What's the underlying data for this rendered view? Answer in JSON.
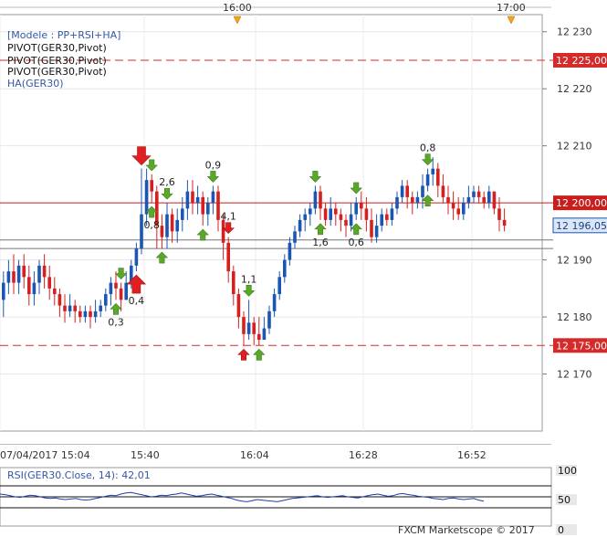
{
  "chart_data": [
    {
      "type": "candlestick",
      "symbol": "GER30",
      "legend": [
        "[Modele : PP+RSI+HA]",
        "PIVOT(GER30,Pivot)",
        "PIVOT(GER30,Pivot)",
        "PIVOT(GER30,Pivot)",
        "HA(GER30)"
      ],
      "top_time_labels": [
        "16:00",
        "17:00"
      ],
      "x_tick_labels": [
        "07/04/2017 15:04",
        "15:40",
        "16:04",
        "16:28",
        "16:52"
      ],
      "y_tick_labels": [
        "12 230",
        "12 220",
        "12 210",
        "12 190",
        "12 180",
        "12 170"
      ],
      "ylim": [
        12160,
        12233
      ],
      "levels": [
        {
          "value": 12225,
          "label": "12 225,00",
          "style": "dashed",
          "color": "#d42a2a"
        },
        {
          "value": 12200,
          "label": "12 200,00",
          "style": "solid",
          "color": "#c81e1e"
        },
        {
          "value": 12175,
          "label": "12 175,00",
          "style": "dashed",
          "color": "#d42a2a"
        },
        {
          "value": 12192,
          "label": "",
          "style": "solid",
          "color": "#777777"
        },
        {
          "value": 12193.5,
          "label": "",
          "style": "solid",
          "color": "#777777"
        }
      ],
      "last_price": {
        "value": 12196.05,
        "label": "12 196,05"
      },
      "bull_color": "#1b56b5",
      "bear_color": "#d62020",
      "candles": [
        [
          12183,
          12186,
          12180,
          12188
        ],
        [
          12186,
          12188,
          12184,
          12190
        ],
        [
          12188,
          12186,
          12184,
          12191
        ],
        [
          12186,
          12189,
          12184,
          12190
        ],
        [
          12189,
          12187,
          12185,
          12191
        ],
        [
          12187,
          12184,
          12182,
          12189
        ],
        [
          12184,
          12186,
          12182,
          12188
        ],
        [
          12186,
          12189,
          12184,
          12190
        ],
        [
          12189,
          12187,
          12185,
          12191
        ],
        [
          12187,
          12185,
          12183,
          12189
        ],
        [
          12185,
          12184,
          12182,
          12187
        ],
        [
          12184,
          12182,
          12180,
          12185
        ],
        [
          12182,
          12181,
          12179,
          12184
        ],
        [
          12181,
          12182,
          12180,
          12184
        ],
        [
          12182,
          12181,
          12179,
          12183
        ],
        [
          12181,
          12180,
          12179,
          12182
        ],
        [
          12180,
          12181,
          12179,
          12182
        ],
        [
          12181,
          12180,
          12178,
          12182
        ],
        [
          12180,
          12181,
          12179,
          12183
        ],
        [
          12181,
          12182,
          12180,
          12183
        ],
        [
          12182,
          12184,
          12181,
          12185
        ],
        [
          12184,
          12186,
          12182,
          12187
        ],
        [
          12186,
          12185,
          12183,
          12188
        ],
        [
          12185,
          12183,
          12181,
          12186
        ],
        [
          12183,
          12186,
          12183,
          12188
        ],
        [
          12186,
          12189,
          12185,
          12190
        ],
        [
          12189,
          12192,
          12188,
          12193
        ],
        [
          12192,
          12198,
          12191,
          12206
        ],
        [
          12198,
          12204,
          12196,
          12206
        ],
        [
          12204,
          12202,
          12200,
          12205
        ],
        [
          12202,
          12196,
          12192,
          12203
        ],
        [
          12196,
          12194,
          12192,
          12198
        ],
        [
          12194,
          12198,
          12192,
          12200
        ],
        [
          12198,
          12195,
          12193,
          12199
        ],
        [
          12195,
          12197,
          12193,
          12199
        ],
        [
          12197,
          12199,
          12195,
          12201
        ],
        [
          12199,
          12202,
          12197,
          12204
        ],
        [
          12202,
          12200,
          12198,
          12204
        ],
        [
          12200,
          12201,
          12198,
          12203
        ],
        [
          12201,
          12198,
          12196,
          12202
        ],
        [
          12198,
          12200,
          12196,
          12201
        ],
        [
          12200,
          12202,
          12198,
          12203
        ],
        [
          12202,
          12197,
          12195,
          12203
        ],
        [
          12197,
          12193,
          12190,
          12198
        ],
        [
          12193,
          12188,
          12186,
          12194
        ],
        [
          12188,
          12184,
          12182,
          12189
        ],
        [
          12184,
          12180,
          12178,
          12185
        ],
        [
          12180,
          12177,
          12175,
          12181
        ],
        [
          12177,
          12179,
          12176,
          12183
        ],
        [
          12179,
          12177,
          12175,
          12180
        ],
        [
          12177,
          12176,
          12175,
          12180
        ],
        [
          12176,
          12178,
          12176,
          12180
        ],
        [
          12178,
          12181,
          12177,
          12182
        ],
        [
          12181,
          12184,
          12180,
          12185
        ],
        [
          12184,
          12187,
          12183,
          12188
        ],
        [
          12187,
          12190,
          12186,
          12191
        ],
        [
          12190,
          12193,
          12189,
          12194
        ],
        [
          12193,
          12195,
          12192,
          12196
        ],
        [
          12195,
          12197,
          12194,
          12198
        ],
        [
          12197,
          12198,
          12195,
          12199
        ],
        [
          12198,
          12199,
          12196,
          12200
        ],
        [
          12199,
          12202,
          12198,
          12203
        ],
        [
          12202,
          12199,
          12197,
          12203
        ],
        [
          12199,
          12197,
          12196,
          12200
        ],
        [
          12197,
          12199,
          12196,
          12201
        ],
        [
          12199,
          12198,
          12196,
          12200
        ],
        [
          12198,
          12197,
          12195,
          12199
        ],
        [
          12197,
          12196,
          12194,
          12198
        ],
        [
          12196,
          12198,
          12195,
          12200
        ],
        [
          12198,
          12200,
          12197,
          12201
        ],
        [
          12200,
          12199,
          12197,
          12202
        ],
        [
          12199,
          12197,
          12195,
          12201
        ],
        [
          12197,
          12194,
          12193,
          12199
        ],
        [
          12194,
          12196,
          12193,
          12198
        ],
        [
          12196,
          12198,
          12195,
          12199
        ],
        [
          12198,
          12197,
          12196,
          12199
        ],
        [
          12197,
          12199,
          12196,
          12200
        ],
        [
          12199,
          12201,
          12198,
          12202
        ],
        [
          12201,
          12203,
          12200,
          12204
        ],
        [
          12203,
          12201,
          12199,
          12204
        ],
        [
          12201,
          12200,
          12198,
          12202
        ],
        [
          12200,
          12201,
          12199,
          12202
        ],
        [
          12201,
          12203,
          12199,
          12205
        ],
        [
          12203,
          12205,
          12202,
          12206
        ],
        [
          12205,
          12206,
          12203,
          12208
        ],
        [
          12206,
          12203,
          12201,
          12207
        ],
        [
          12203,
          12201,
          12200,
          12205
        ],
        [
          12201,
          12200,
          12198,
          12203
        ],
        [
          12200,
          12199,
          12197,
          12202
        ],
        [
          12199,
          12198,
          12197,
          12201
        ],
        [
          12198,
          12200,
          12197,
          12201
        ],
        [
          12200,
          12201,
          12199,
          12203
        ],
        [
          12201,
          12202,
          12200,
          12203
        ],
        [
          12202,
          12201,
          12200,
          12203
        ],
        [
          12201,
          12200,
          12199,
          12202
        ],
        [
          12200,
          12202,
          12199,
          12203
        ],
        [
          12202,
          12199,
          12198,
          12202
        ],
        [
          12199,
          12197,
          12195,
          12201
        ],
        [
          12197,
          12196,
          12195,
          12199
        ]
      ],
      "signals": [
        {
          "i": 27,
          "dir": "down",
          "color": "red",
          "label": ""
        },
        {
          "i": 29,
          "dir": "down",
          "color": "green",
          "label": ""
        },
        {
          "i": 32,
          "dir": "down",
          "color": "green",
          "label": "2,6"
        },
        {
          "i": 41,
          "dir": "down",
          "color": "green",
          "label": "0,9"
        },
        {
          "i": 23,
          "dir": "down",
          "color": "green",
          "label": ""
        },
        {
          "i": 22,
          "dir": "up",
          "color": "green",
          "label": "0,3"
        },
        {
          "i": 26,
          "dir": "up",
          "color": "red",
          "label": "0,4"
        },
        {
          "i": 29,
          "dir": "up",
          "color": "green",
          "label": "0,8"
        },
        {
          "i": 31,
          "dir": "up",
          "color": "green",
          "label": ""
        },
        {
          "i": 39,
          "dir": "up",
          "color": "green",
          "label": ""
        },
        {
          "i": 44,
          "dir": "down",
          "color": "red",
          "label": "4,1"
        },
        {
          "i": 47,
          "dir": "up",
          "color": "red",
          "label": ""
        },
        {
          "i": 50,
          "dir": "up",
          "color": "green",
          "label": ""
        },
        {
          "i": 48,
          "dir": "down",
          "color": "green",
          "label": "1,1"
        },
        {
          "i": 61,
          "dir": "down",
          "color": "green",
          "label": ""
        },
        {
          "i": 62,
          "dir": "up",
          "color": "green",
          "label": "1,6"
        },
        {
          "i": 69,
          "dir": "down",
          "color": "green",
          "label": ""
        },
        {
          "i": 69,
          "dir": "up",
          "color": "green",
          "label": "0,6"
        },
        {
          "i": 83,
          "dir": "down",
          "color": "green",
          "label": "0,8"
        },
        {
          "i": 83,
          "dir": "up",
          "color": "green",
          "label": ""
        }
      ]
    },
    {
      "type": "line",
      "title": "RSI(GER30.Close, 14): 42,01",
      "y_tick_labels": [
        "100",
        "50",
        "0"
      ],
      "levels": [
        70,
        50,
        30
      ],
      "ylim": [
        0,
        100
      ],
      "values": [
        55,
        54,
        52,
        50,
        49,
        51,
        53,
        52,
        50,
        48,
        47,
        48,
        46,
        45,
        46,
        47,
        45,
        44,
        45,
        47,
        49,
        51,
        53,
        52,
        55,
        57,
        58,
        56,
        54,
        52,
        50,
        51,
        53,
        52,
        54,
        55,
        57,
        55,
        53,
        51,
        52,
        54,
        55,
        53,
        51,
        49,
        47,
        44,
        42,
        41,
        43,
        45,
        44,
        43,
        42,
        41,
        43,
        45,
        47,
        48,
        49,
        50,
        51,
        52,
        50,
        49,
        50,
        51,
        52,
        50,
        49,
        48,
        50,
        52,
        54,
        55,
        53,
        51,
        52,
        55,
        56,
        54,
        53,
        51,
        50,
        49,
        47,
        46,
        45,
        47,
        48,
        46,
        45,
        46,
        47,
        44,
        42
      ]
    }
  ],
  "watermark": "FXCM Marketscope © 2017"
}
